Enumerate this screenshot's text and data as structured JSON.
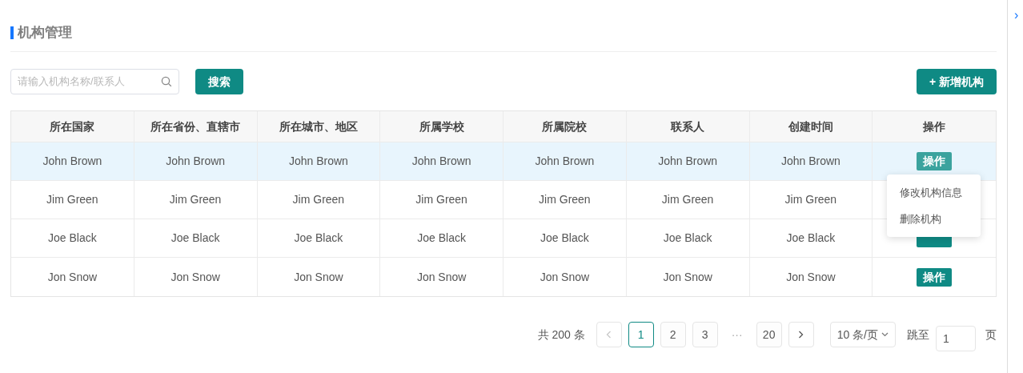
{
  "title": "机构管理",
  "search": {
    "placeholder": "请输入机构名称/联系人",
    "button": "搜索"
  },
  "add_button": "+ 新增机构",
  "table": {
    "columns": [
      "所在国家",
      "所在省份、直辖市",
      "所在城市、地区",
      "所属学校",
      "所属院校",
      "联系人",
      "创建时间",
      "操作"
    ],
    "rows": [
      {
        "cells": [
          "John Brown",
          "John Brown",
          "John Brown",
          "John Brown",
          "John Brown",
          "John Brown",
          "John Brown"
        ],
        "action": "操作",
        "highlighted": true
      },
      {
        "cells": [
          "Jim Green",
          "Jim Green",
          "Jim Green",
          "Jim Green",
          "Jim Green",
          "Jim Green",
          "Jim Green"
        ],
        "highlighted": false
      },
      {
        "cells": [
          "Joe Black",
          "Joe Black",
          "Joe Black",
          "Joe Black",
          "Joe Black",
          "Joe Black",
          "Joe Black"
        ],
        "action_button_covered": true,
        "highlighted": false
      },
      {
        "cells": [
          "Jon Snow",
          "Jon Snow",
          "Jon Snow",
          "Jon Snow",
          "Jon Snow",
          "Jon Snow",
          "Jon Snow"
        ],
        "action": "操作",
        "highlighted": false
      }
    ]
  },
  "action_menu": {
    "items": [
      "修改机构信息",
      "删除机构"
    ]
  },
  "pagination": {
    "total": "共 200 条",
    "pages": [
      {
        "kind": "page",
        "label": "1",
        "selected": true
      },
      {
        "kind": "page",
        "label": "2",
        "selected": false
      },
      {
        "kind": "page",
        "label": "3",
        "selected": false
      },
      {
        "kind": "ellipsis",
        "label": "···"
      },
      {
        "kind": "page",
        "label": "20",
        "selected": false
      }
    ],
    "page_size": "10 条/页",
    "jump_label": "跳至",
    "jump_value": "1",
    "page_suffix": "页"
  },
  "side_panel": {
    "toggle": "›"
  }
}
